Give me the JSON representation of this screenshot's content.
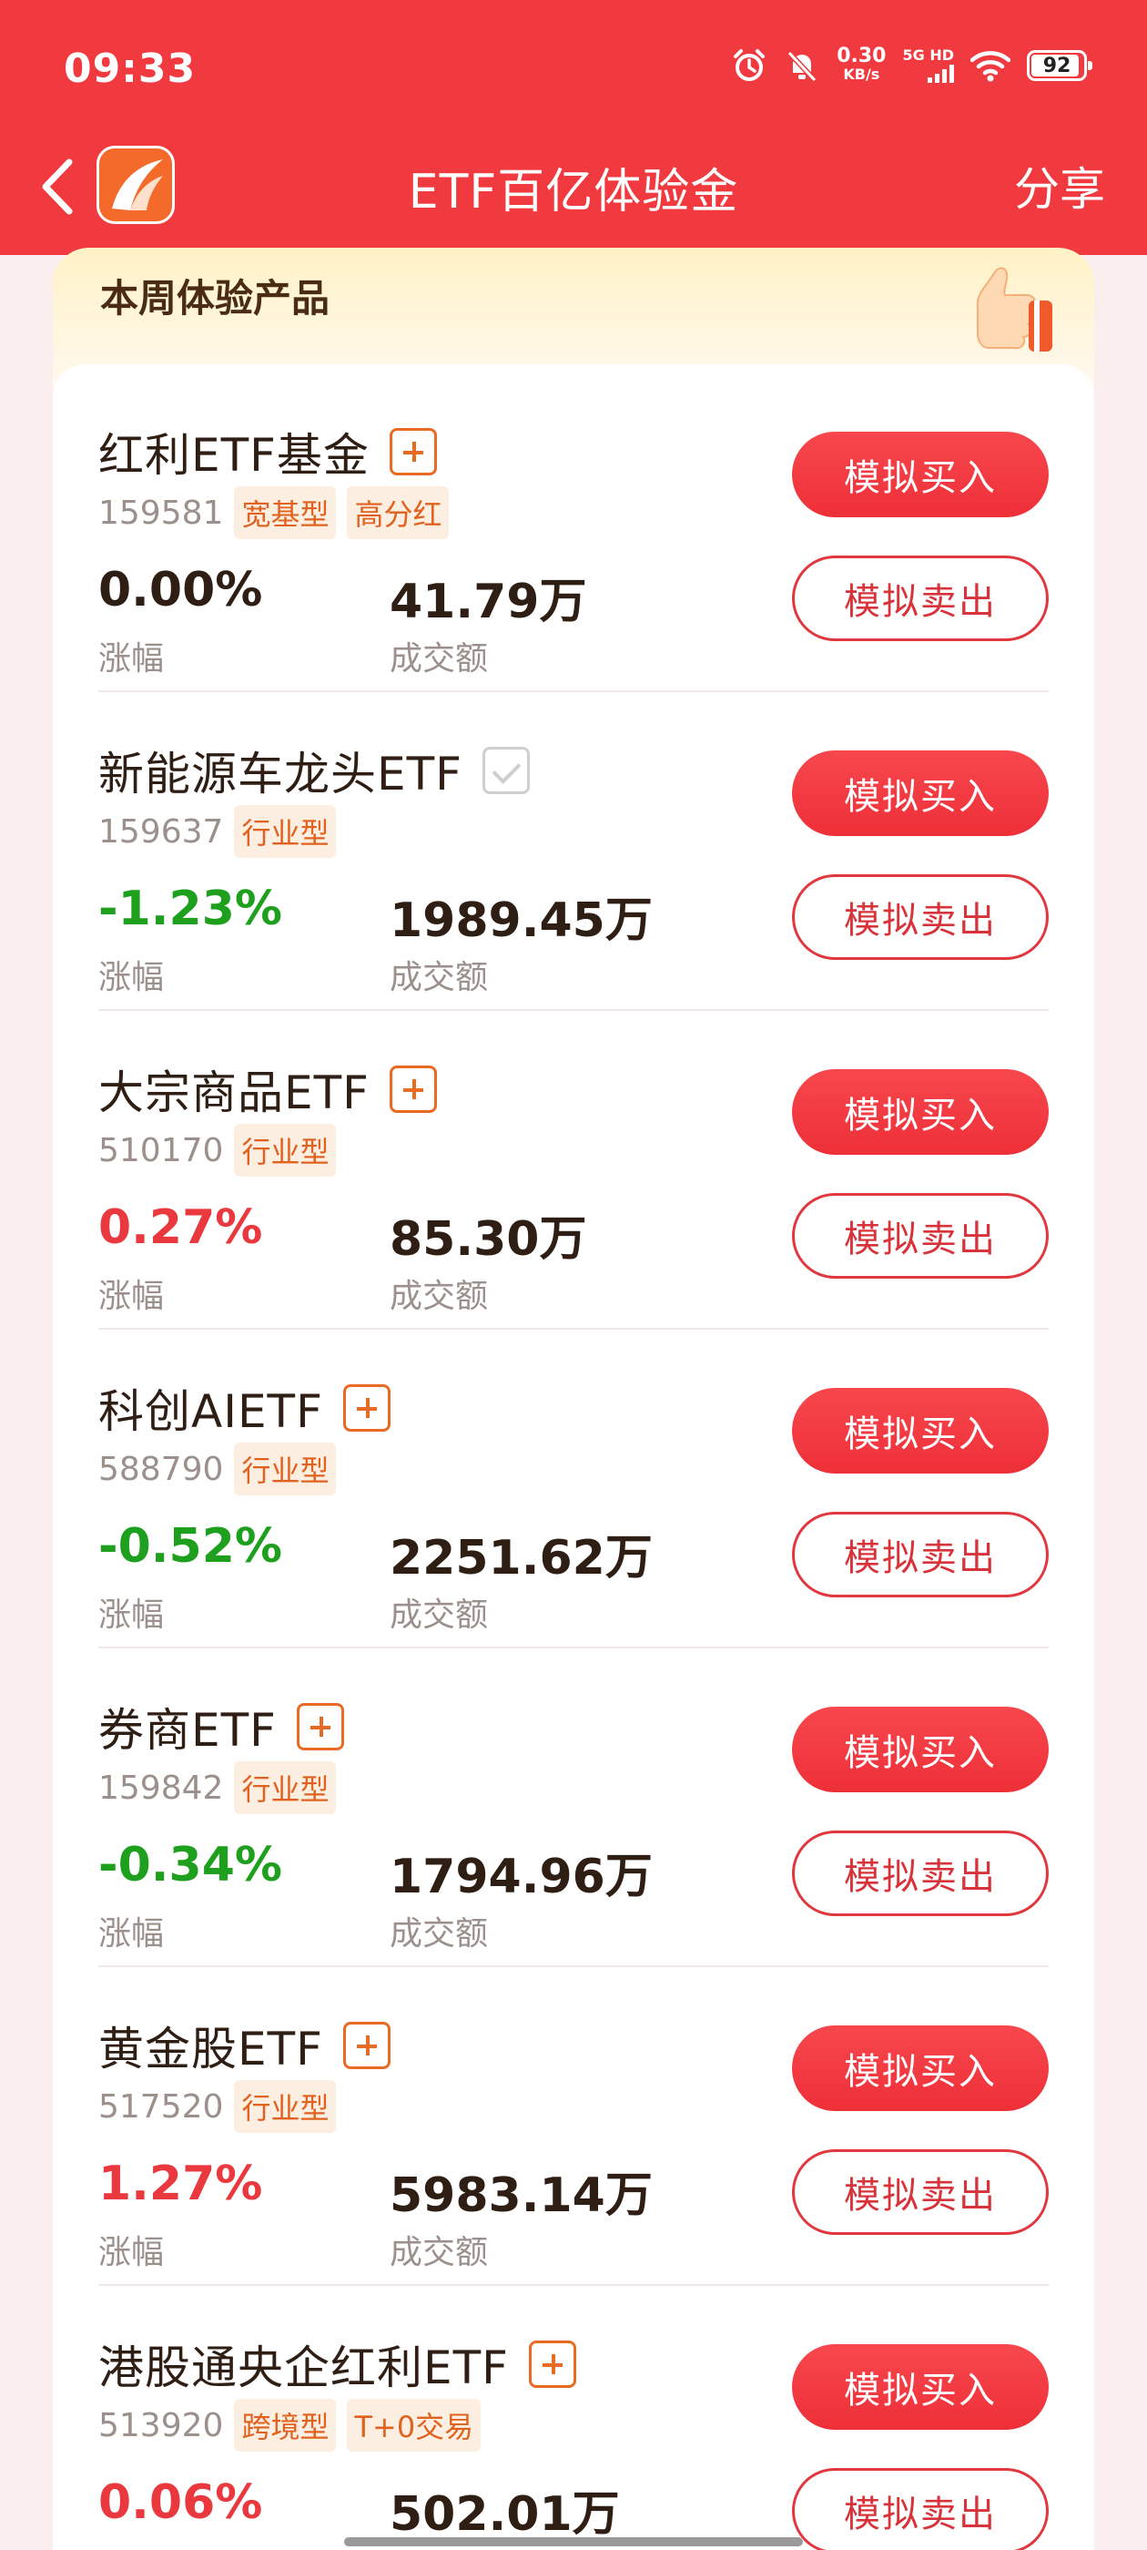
{
  "status_bar": {
    "time": "09:33",
    "net_speed": "0.30",
    "net_unit": "KB/s",
    "signal_label": "5G HD",
    "battery": "92"
  },
  "nav": {
    "title": "ETF百亿体验金",
    "share_label": "分享"
  },
  "section": {
    "title": "本周体验产品"
  },
  "labels": {
    "change": "涨幅",
    "volume": "成交额",
    "buy": "模拟买入",
    "sell": "模拟卖出"
  },
  "colors": {
    "brand_red": "#f03a3f",
    "rise_red": "#e9383e",
    "fall_green": "#1ea01e",
    "tag_orange": "#e0621e"
  },
  "products": [
    {
      "name": "红利ETF基金",
      "code": "159581",
      "tags": [
        "宽基型",
        "高分红"
      ],
      "change": "0.00%",
      "volume": "41.79万",
      "trend": "flat",
      "added": false
    },
    {
      "name": "新能源车龙头ETF",
      "code": "159637",
      "tags": [
        "行业型"
      ],
      "change": "-1.23%",
      "volume": "1989.45万",
      "trend": "down",
      "added": true
    },
    {
      "name": "大宗商品ETF",
      "code": "510170",
      "tags": [
        "行业型"
      ],
      "change": "0.27%",
      "volume": "85.30万",
      "trend": "up",
      "added": false
    },
    {
      "name": "科创AIETF",
      "code": "588790",
      "tags": [
        "行业型"
      ],
      "change": "-0.52%",
      "volume": "2251.62万",
      "trend": "down",
      "added": false
    },
    {
      "name": "券商ETF",
      "code": "159842",
      "tags": [
        "行业型"
      ],
      "change": "-0.34%",
      "volume": "1794.96万",
      "trend": "down",
      "added": false
    },
    {
      "name": "黄金股ETF",
      "code": "517520",
      "tags": [
        "行业型"
      ],
      "change": "1.27%",
      "volume": "5983.14万",
      "trend": "up",
      "added": false
    },
    {
      "name": "港股通央企红利ETF",
      "code": "513920",
      "tags": [
        "跨境型",
        "T+0交易"
      ],
      "change": "0.06%",
      "volume": "502.01万",
      "trend": "up",
      "added": false
    }
  ]
}
